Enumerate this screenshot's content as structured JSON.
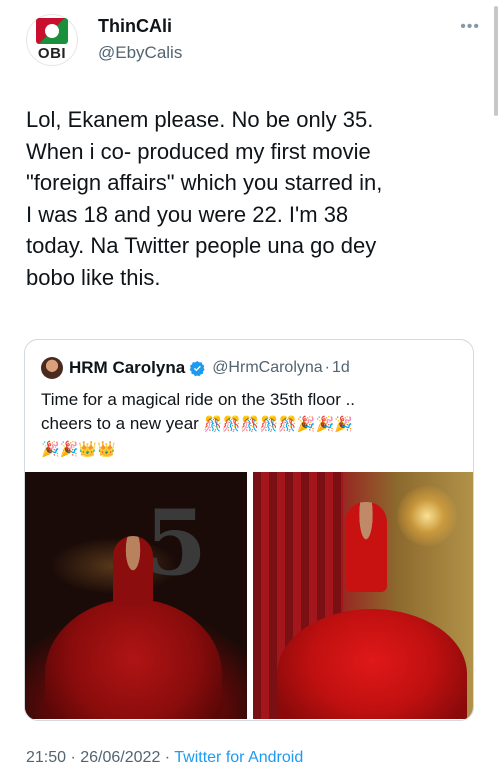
{
  "author": {
    "display_name": "ThinCAli",
    "handle": "@EbyCalis",
    "avatar_badge_text": "OBI"
  },
  "tweet": {
    "text": "Lol, Ekanem please. No be only 35.\nWhen i co- produced my first movie\n\"foreign affairs\" which you starred in,\nI was 18 and you were 22. I'm 38\ntoday. Na Twitter people una go dey\nbobo like this.",
    "timestamp": "21:50 · 26/06/2022 · ",
    "source": "Twitter for Android"
  },
  "quoted": {
    "display_name": "HRM Carolyna",
    "handle": "@HrmCarolyna",
    "separator": "·",
    "time": "1d",
    "text": "Time for a magical ride on the 35th floor ..\ncheers to a new year ",
    "emoji_line": "🎊🎊🎊🎊🎊🎉🎉🎉\n🎉🎉👑👑",
    "verified": true
  },
  "colors": {
    "accent": "#1d9bf0",
    "text": "#0f1419",
    "muted": "#536471",
    "border": "#cfd9de"
  },
  "icons": {
    "more": "more-horizontal-icon",
    "verified": "verified-badge-icon"
  }
}
